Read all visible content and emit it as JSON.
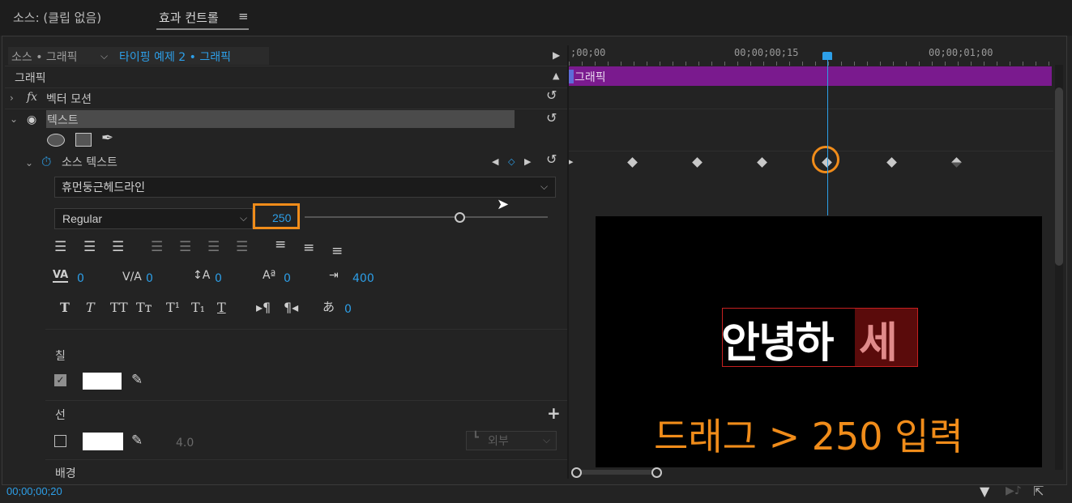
{
  "tabs": {
    "source": "소스: (클립 없음)",
    "effect_controls": "효과 컨트롤",
    "menu_icon": "≡"
  },
  "header": {
    "source_name": "소스 • 그래픽",
    "clip_name": "타이핑 예제 2 • 그래픽"
  },
  "section": {
    "graphic": "그래픽"
  },
  "rows": {
    "vector_motion": "벡터 모션",
    "text": "텍스트",
    "source_text": "소스 텍스트",
    "fx": "fx"
  },
  "font": {
    "family": "휴먼둥근헤드라인",
    "style": "Regular",
    "size": "250"
  },
  "spacing": {
    "kerning": "0",
    "tracking": "0",
    "leading": "0",
    "baseline": "0",
    "tab_width": "400",
    "tsume": "0"
  },
  "appearance": {
    "fill_label": "칠",
    "fill_checked": true,
    "fill_color": "#ffffff",
    "stroke_label": "선",
    "stroke_checked": false,
    "stroke_color": "#ffffff",
    "stroke_width": "4.0",
    "stroke_type": "외부",
    "background_label": "배경"
  },
  "timeline": {
    "t0": ";00;00",
    "t1": "00;00;00;15",
    "t2": "00;00;01;00",
    "clip_label": "그래픽",
    "keyframe_count": 7
  },
  "preview": {
    "main_text_white": "안녕하",
    "main_text_red": "세",
    "caption": "드래그 > 250 입력"
  },
  "status": {
    "timecode": "00;00;00;20"
  },
  "colors": {
    "accent_blue": "#2d9fe8",
    "highlight_orange": "#f08c1a",
    "clip_purple": "#7a1a8e",
    "caption_orange": "#f08c1a"
  }
}
